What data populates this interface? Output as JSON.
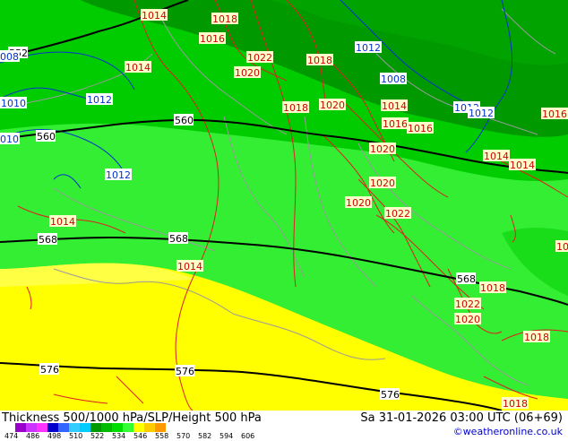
{
  "footer": {
    "title": "Thickness 500/1000 hPa/SLP/Height 500 hPa",
    "datetime": "Sa 31-01-2026 03:00 UTC (06+69)",
    "credit": "©weatheronline.co.uk"
  },
  "legend": {
    "ticks": [
      "474",
      "486",
      "498",
      "510",
      "522",
      "534",
      "546",
      "558",
      "570",
      "582",
      "594",
      "606"
    ],
    "colors": [
      "#9900cc",
      "#cc33ff",
      "#ff33ff",
      "#0000cc",
      "#3366ff",
      "#33ccff",
      "#00ccff",
      "#009900",
      "#00bb00",
      "#00dd00",
      "#33ff33",
      "#ffff00",
      "#ffcc00",
      "#ff9900"
    ]
  },
  "map": {
    "height_labels": [
      "552",
      "560",
      "560",
      "568",
      "568",
      "568",
      "576",
      "576",
      "576",
      "560"
    ],
    "pressure_labels_red": [
      "1014",
      "1018",
      "1016",
      "1022",
      "1018",
      "1014",
      "1020",
      "1018",
      "1020",
      "1014",
      "1016",
      "1016",
      "1014",
      "1014",
      "1016",
      "1020",
      "1020",
      "1020",
      "1022",
      "1014",
      "1014",
      "1018",
      "1022",
      "1020",
      "1018",
      "1018",
      "10"
    ],
    "pressure_labels_blue": [
      "1012",
      "1008",
      "008",
      "1010",
      "1012",
      "1012",
      "010",
      "1012",
      "1012"
    ],
    "colors": {
      "yellow": "#ffff00",
      "light_yellow": "#ffff55",
      "green_light": "#33ee33",
      "green_mid": "#00cc00",
      "green_dark": "#009900",
      "red_isobar": "#dd2222",
      "blue_isobar": "#0033cc",
      "height_contour": "#000000",
      "border": "#aaaaaa"
    }
  }
}
